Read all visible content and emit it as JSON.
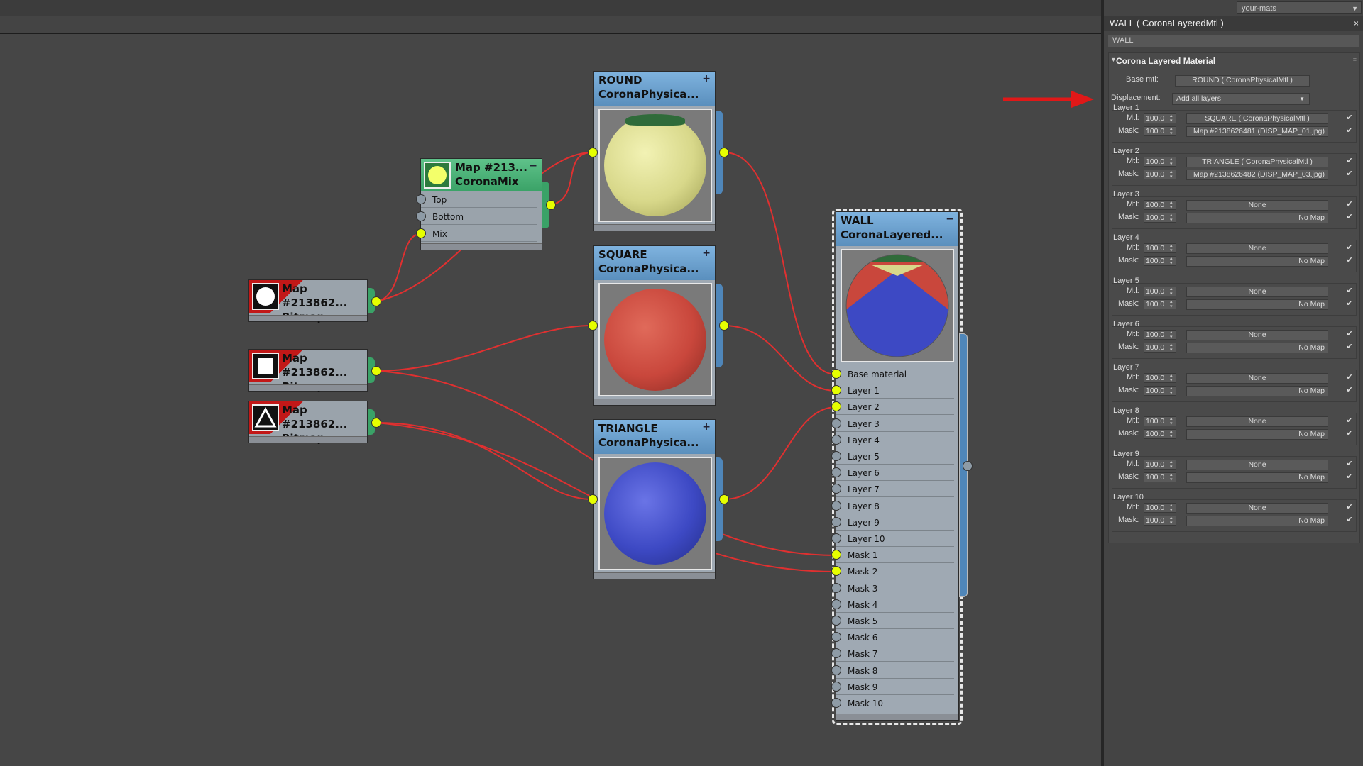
{
  "panel": {
    "top_dropdown": "your-mats",
    "title": "WALL  ( CoronaLayeredMtl )",
    "name_field": "WALL",
    "rollout_title": "Corona Layered Material",
    "base_mtl_label": "Base mtl:",
    "base_mtl_value": "ROUND  ( CoronaPhysicalMtl )",
    "displacement_label": "Displacement:",
    "displacement_value": "Add all layers",
    "mtl_label": "Mtl:",
    "mask_label": "Mask:",
    "layers": [
      {
        "title": "Layer 1",
        "mtl_amt": "100.0",
        "mask_amt": "100.0",
        "mtl": "SQUARE  ( CoronaPhysicalMtl )",
        "mask": "Map #2138626481 (DISP_MAP_01.jpg)"
      },
      {
        "title": "Layer 2",
        "mtl_amt": "100.0",
        "mask_amt": "100.0",
        "mtl": "TRIANGLE  ( CoronaPhysicalMtl )",
        "mask": "Map #2138626482 (DISP_MAP_03.jpg)"
      },
      {
        "title": "Layer 3",
        "mtl_amt": "100.0",
        "mask_amt": "100.0",
        "mtl": "None",
        "mask": "No Map"
      },
      {
        "title": "Layer 4",
        "mtl_amt": "100.0",
        "mask_amt": "100.0",
        "mtl": "None",
        "mask": "No Map"
      },
      {
        "title": "Layer 5",
        "mtl_amt": "100.0",
        "mask_amt": "100.0",
        "mtl": "None",
        "mask": "No Map"
      },
      {
        "title": "Layer 6",
        "mtl_amt": "100.0",
        "mask_amt": "100.0",
        "mtl": "None",
        "mask": "No Map"
      },
      {
        "title": "Layer 7",
        "mtl_amt": "100.0",
        "mask_amt": "100.0",
        "mtl": "None",
        "mask": "No Map"
      },
      {
        "title": "Layer 8",
        "mtl_amt": "100.0",
        "mask_amt": "100.0",
        "mtl": "None",
        "mask": "No Map"
      },
      {
        "title": "Layer 9",
        "mtl_amt": "100.0",
        "mask_amt": "100.0",
        "mtl": "None",
        "mask": "No Map"
      },
      {
        "title": "Layer 10",
        "mtl_amt": "100.0",
        "mask_amt": "100.0",
        "mtl": "None",
        "mask": "No Map"
      }
    ]
  },
  "nodes": {
    "round": {
      "title": "ROUND",
      "subtitle": "CoronaPhysica...",
      "corner": "+",
      "color": "#e0e08a"
    },
    "square": {
      "title": "SQUARE",
      "subtitle": "CoronaPhysica...",
      "corner": "+",
      "color": "#c9473c"
    },
    "triangle": {
      "title": "TRIANGLE",
      "subtitle": "CoronaPhysica...",
      "corner": "+",
      "color": "#3d49c4"
    },
    "wall": {
      "title": "WALL",
      "subtitle": "CoronaLayered...",
      "corner": "−",
      "slots": [
        "Base material",
        "Layer 1",
        "Layer 2",
        "Layer 3",
        "Layer 4",
        "Layer 5",
        "Layer 6",
        "Layer 7",
        "Layer 8",
        "Layer 9",
        "Layer 10",
        "Mask 1",
        "Mask 2",
        "Mask 3",
        "Mask 4",
        "Mask 5",
        "Mask 6",
        "Mask 7",
        "Mask 8",
        "Mask 9",
        "Mask 10"
      ],
      "connected": [
        true,
        true,
        true,
        false,
        false,
        false,
        false,
        false,
        false,
        false,
        false,
        true,
        true,
        false,
        false,
        false,
        false,
        false,
        false,
        false,
        false
      ]
    },
    "mix": {
      "title": "Map #213...",
      "subtitle": "CoronaMix",
      "corner": "−",
      "slots": [
        "Top",
        "Bottom",
        "Mix"
      ],
      "connected": [
        false,
        false,
        true
      ]
    },
    "bitmap1": {
      "title": "Map #213862...",
      "subtitle": "Bitmap",
      "shape": "circle"
    },
    "bitmap2": {
      "title": "Map #213862...",
      "subtitle": "Bitmap",
      "shape": "square"
    },
    "bitmap3": {
      "title": "Map #213862...",
      "subtitle": "Bitmap",
      "shape": "triangle"
    }
  },
  "colors": {
    "wire": "#e03030",
    "socket_on": "#e6ff00",
    "socket_off": "#8e9ba6",
    "arrow": "#e01818"
  }
}
